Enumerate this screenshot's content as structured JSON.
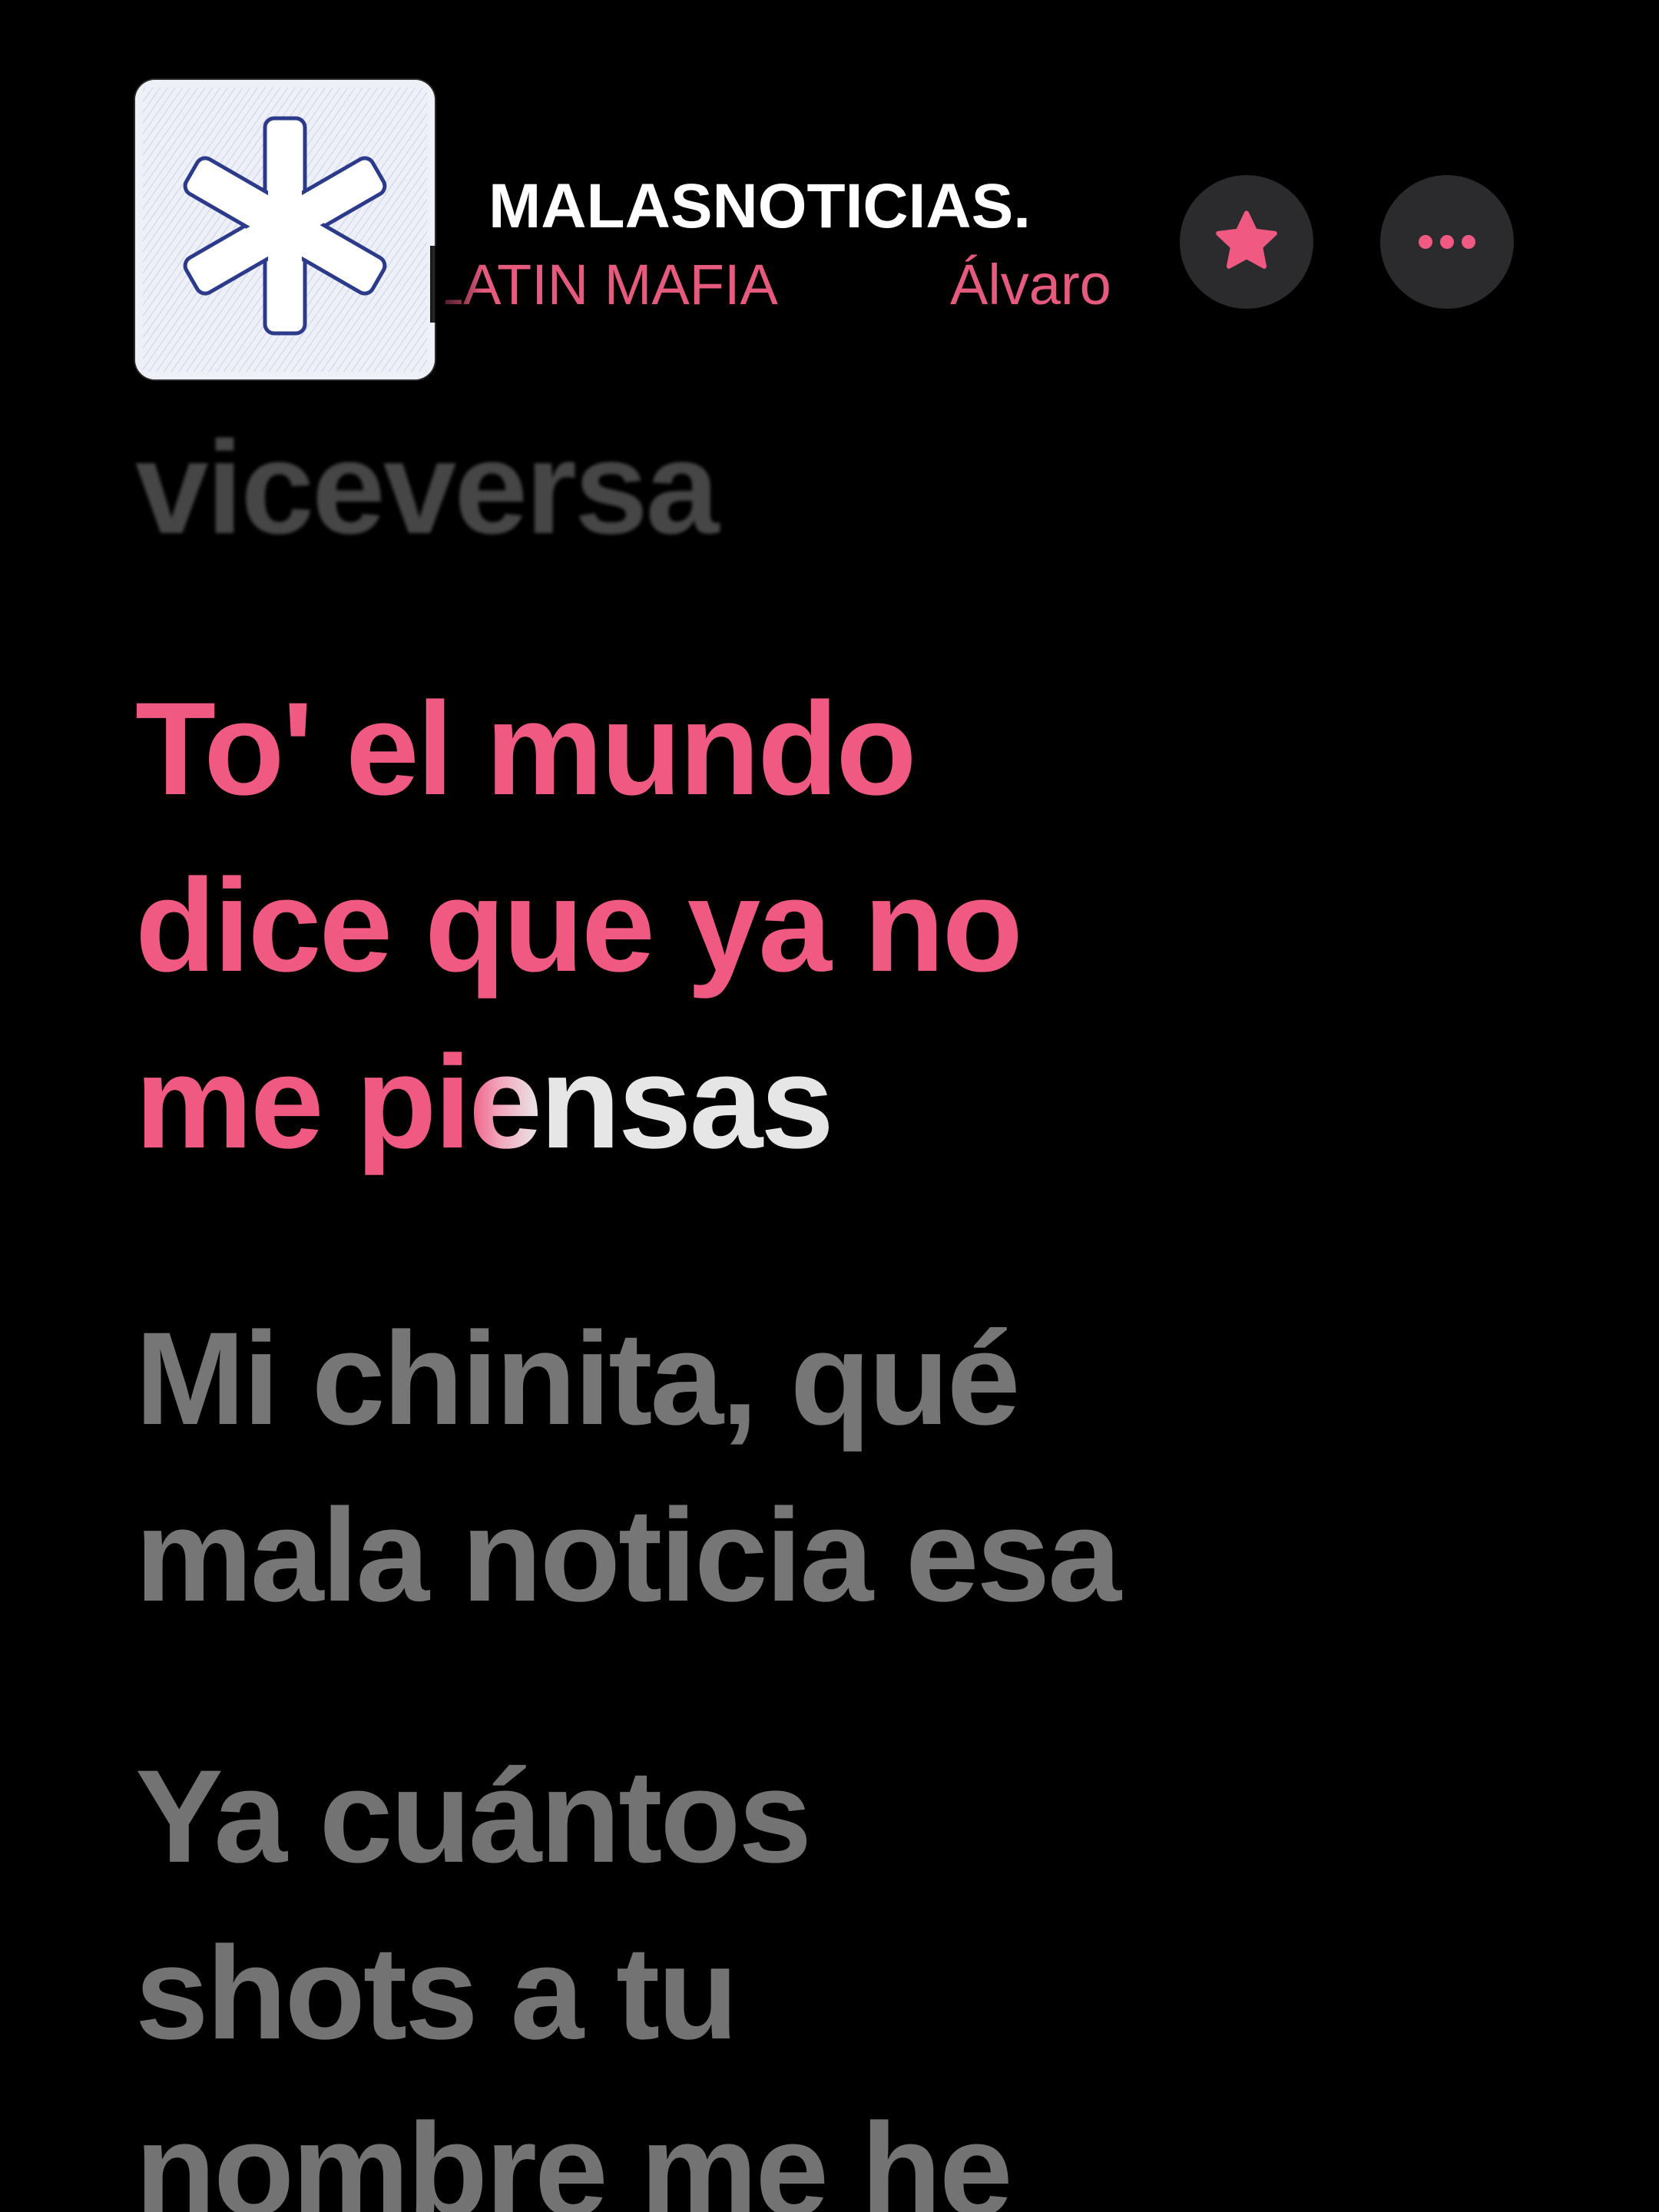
{
  "now_playing": {
    "title": "MALASNOTICIAS.",
    "artists_marquee": [
      "LATIN MAFIA",
      "Álvaro"
    ]
  },
  "buttons": {
    "favorite_icon": "star-icon",
    "more_icon": "ellipsis-icon"
  },
  "colors": {
    "accent": "#f05a82",
    "background": "#000000",
    "inactive_lyric": "#767676",
    "button_bg": "#2b2b2d"
  },
  "lyrics": {
    "previous": "viceversa",
    "current": {
      "line1": "To' el mundo",
      "line2": "dice que ya no",
      "line3_sung": "me pi",
      "line3_partial": "e",
      "line3_unsung": "nsas"
    },
    "next1": {
      "line1": "Mi chinita, qué",
      "line2": "mala noticia esa"
    },
    "next2": {
      "line1": "Ya cuántos",
      "line2": "shots a tu",
      "line3": "nombre me he"
    }
  }
}
